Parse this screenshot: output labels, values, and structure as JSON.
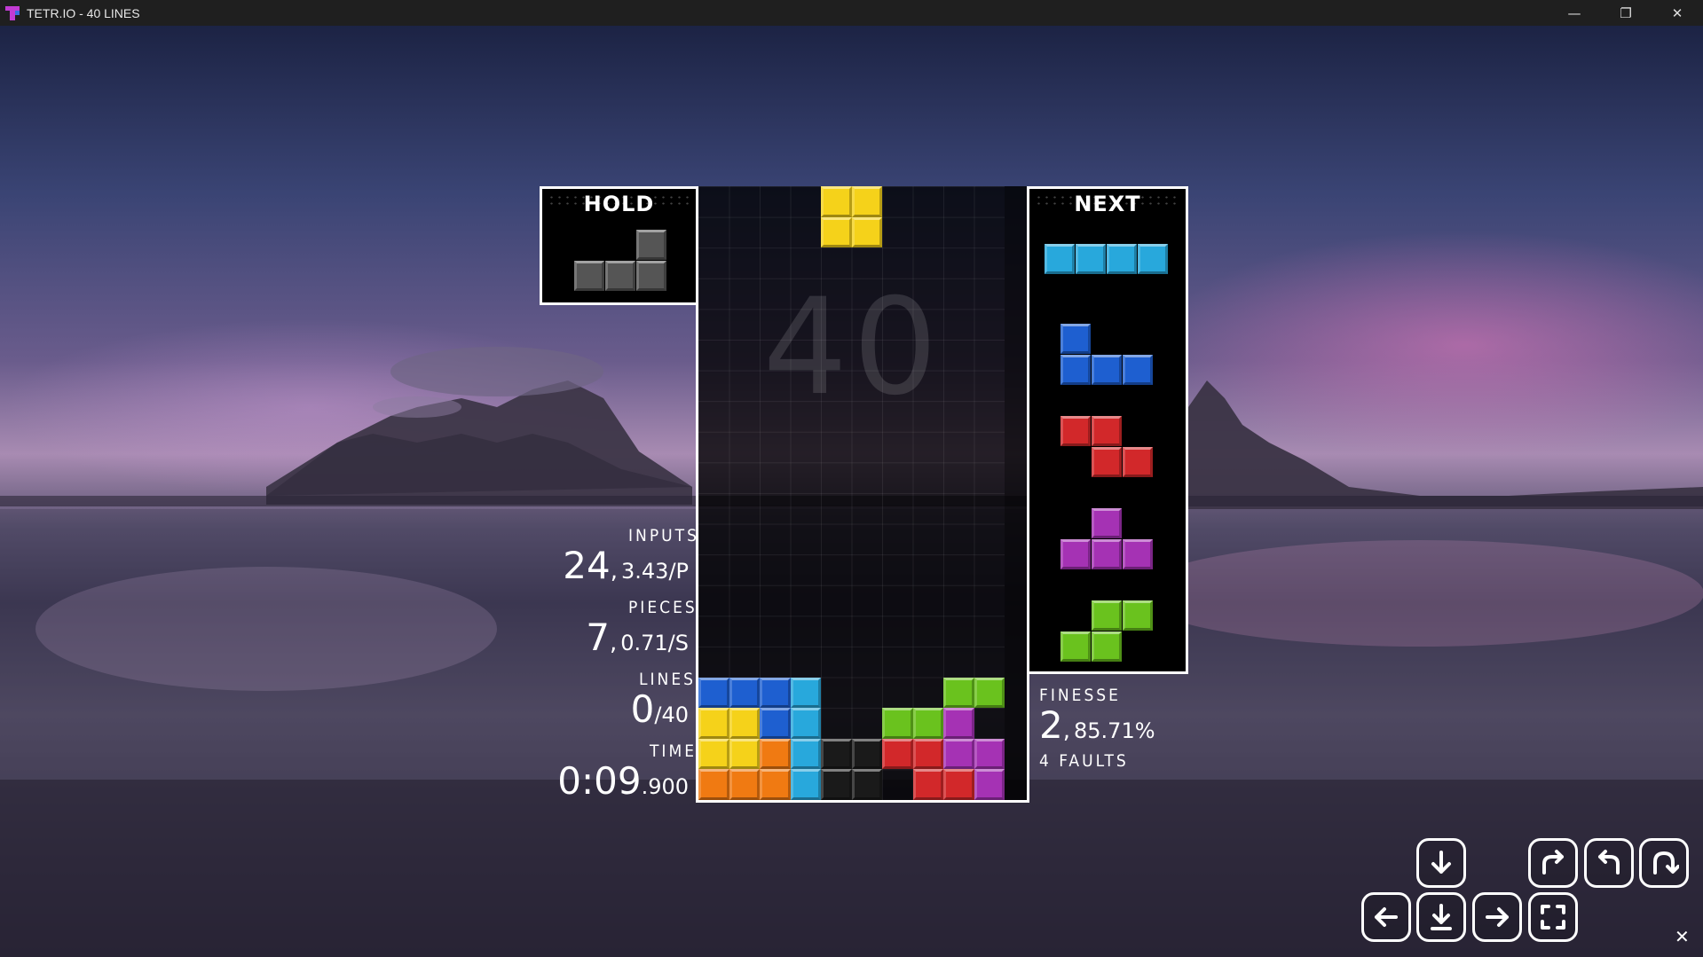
{
  "window": {
    "title": "TETR.IO - 40 LINES",
    "minimize": "—",
    "restore": "❐",
    "close": "✕"
  },
  "hold": {
    "label": "HOLD",
    "piece": "L",
    "color": "#555555"
  },
  "next": {
    "label": "NEXT",
    "queue": [
      "I",
      "J",
      "Z",
      "T",
      "S"
    ]
  },
  "board": {
    "lines_remaining_watermark": "40",
    "active_piece": "O",
    "colors": {
      "I": "#28a8dc",
      "J": "#1e5fd0",
      "L": "#f07a12",
      "O": "#f5d21a",
      "S": "#6ac21e",
      "Z": "#d2282a",
      "T": "#a532b4",
      "G": "#1a1a1a"
    }
  },
  "stats": {
    "inputs_label": "INPUTS",
    "inputs_value": "24",
    "inputs_rate": "3.43/P",
    "pieces_label": "PIECES",
    "pieces_value": "7",
    "pieces_rate": "0.71/S",
    "lines_label": "LINES",
    "lines_value": "0",
    "lines_target": "/40",
    "time_label": "TIME",
    "time_value": "0:09",
    "time_ms": ".900",
    "finesse_label": "FINESSE",
    "finesse_value": "2",
    "finesse_percent": "85.71%",
    "faults": "4 FAULTS"
  },
  "controls": {
    "soft_drop_icon": "arrow-down-icon",
    "rotate_cw_icon": "rotate-cw-icon",
    "rotate_ccw_icon": "rotate-ccw-icon",
    "rotate_180_icon": "rotate-180-icon",
    "move_left_icon": "arrow-left-icon",
    "hard_drop_icon": "hard-drop-icon",
    "move_right_icon": "arrow-right-icon",
    "fullscreen_icon": "fullscreen-icon"
  }
}
